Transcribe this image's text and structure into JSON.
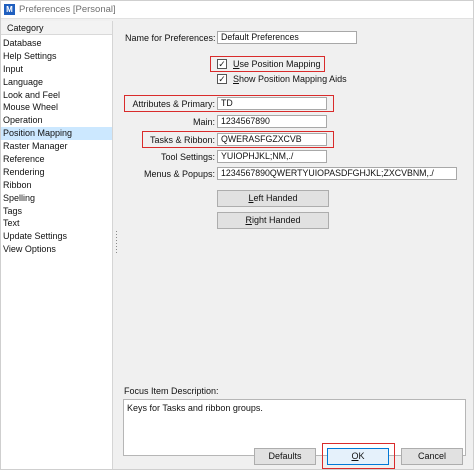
{
  "window": {
    "title": "Preferences [Personal]"
  },
  "category": {
    "header": "Category",
    "items": [
      "Database",
      "Help Settings",
      "Input",
      "Language",
      "Look and Feel",
      "Mouse Wheel",
      "Operation",
      "Position Mapping",
      "Raster Manager",
      "Reference",
      "Rendering",
      "Ribbon",
      "Spelling",
      "Tags",
      "Text",
      "Update Settings",
      "View Options"
    ],
    "selected": "Position Mapping"
  },
  "form": {
    "name_label": "Name for Preferences:",
    "name_value": "Default Preferences",
    "use_position_mapping": {
      "pre": "",
      "u": "U",
      "post": "se Position Mapping",
      "checked": true
    },
    "show_aids": {
      "pre": "",
      "u": "S",
      "post": "how Position Mapping Aids",
      "checked": true
    },
    "fields": [
      {
        "label": "Attributes & Primary:",
        "value": "TD"
      },
      {
        "label": "Main:",
        "value": "1234567890"
      },
      {
        "label": "Tasks & Ribbon:",
        "value": "QWERASFGZXCVB"
      },
      {
        "label": "Tool Settings:",
        "value": "YUIOPHJKL;NM,./"
      },
      {
        "label": "Menus & Popups:",
        "value": "1234567890QWERTYUIOPASDFGHJKL;ZXCVBNM,./"
      }
    ],
    "left_handed": {
      "u": "L",
      "post": "eft Handed"
    },
    "right_handed": {
      "u": "R",
      "post": "ight Handed"
    },
    "focus_label": "Focus Item Description:",
    "focus_text": "Keys for Tasks and ribbon groups."
  },
  "buttons": {
    "defaults": "Defaults",
    "ok": {
      "u": "O",
      "post": "K"
    },
    "cancel": "Cancel"
  },
  "colors": {
    "highlight_border": "#d92b2b",
    "selection": "#cce8ff"
  }
}
